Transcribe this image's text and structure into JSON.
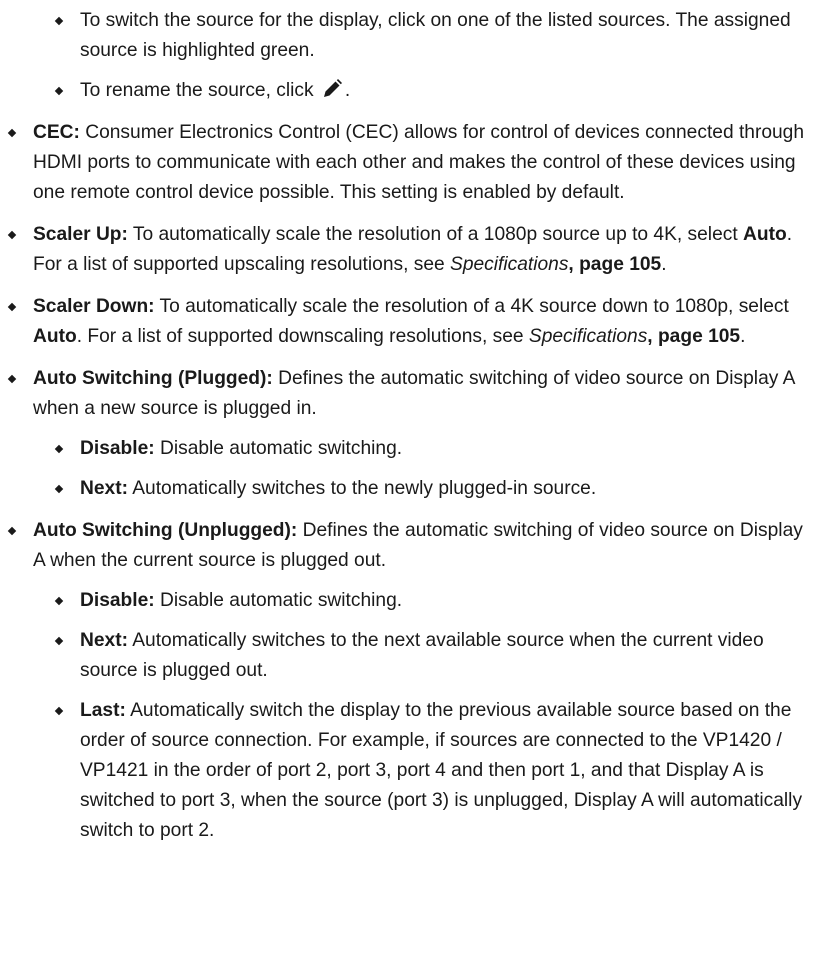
{
  "switch_source": {
    "text": "To switch the source for the display, click on one of the listed sources. The assigned source is highlighted green."
  },
  "rename": {
    "before": "To rename the source, click ",
    "after": ".",
    "icon": "pencil-icon"
  },
  "cec": {
    "label": "CEC:",
    "text": " Consumer Electronics Control (CEC) allows for control of devices connected through HDMI ports to communicate with each other and makes the control of these devices using one remote control device possible. This setting is enabled by default."
  },
  "scaler_up": {
    "label": "Scaler Up:",
    "text1": " To automatically scale the resolution of a 1080p source up to 4K, select ",
    "bold": "Auto",
    "text2": ". For a list of supported upscaling resolutions, see ",
    "ref": "Specifications",
    "page": ", page 105",
    "end": "."
  },
  "scaler_down": {
    "label": "Scaler Down:",
    "text1": " To automatically scale the resolution of a 4K source down to 1080p, select ",
    "bold": "Auto",
    "text2": ". For a list of supported downscaling resolutions, see ",
    "ref": "Specifications",
    "page": ", page 105",
    "end": "."
  },
  "plugged": {
    "label": "Auto Switching (Plugged):",
    "text": " Defines the automatic switching of video source on Display A when a new source is plugged in.",
    "disable_label": "Disable:",
    "disable_text": " Disable automatic switching.",
    "next_label": "Next:",
    "next_text": " Automatically switches to the newly plugged-in source."
  },
  "unplugged": {
    "label": "Auto Switching (Unplugged):",
    "text": " Defines the automatic switching of video source on Display A when the current source is plugged out.",
    "disable_label": "Disable:",
    "disable_text": " Disable automatic switching.",
    "next_label": "Next:",
    "next_text": " Automatically switches to the next available source when the current video source is plugged out.",
    "last_label": "Last:",
    "last_text": " Automatically switch the display to the previous available source based on the order of source connection. For example, if sources are connected to the VP1420 / VP1421 in the order of port 2, port 3, port 4 and then port 1, and that Display A is switched to port 3, when the source (port 3) is unplugged, Display A will automatically switch to port 2."
  }
}
